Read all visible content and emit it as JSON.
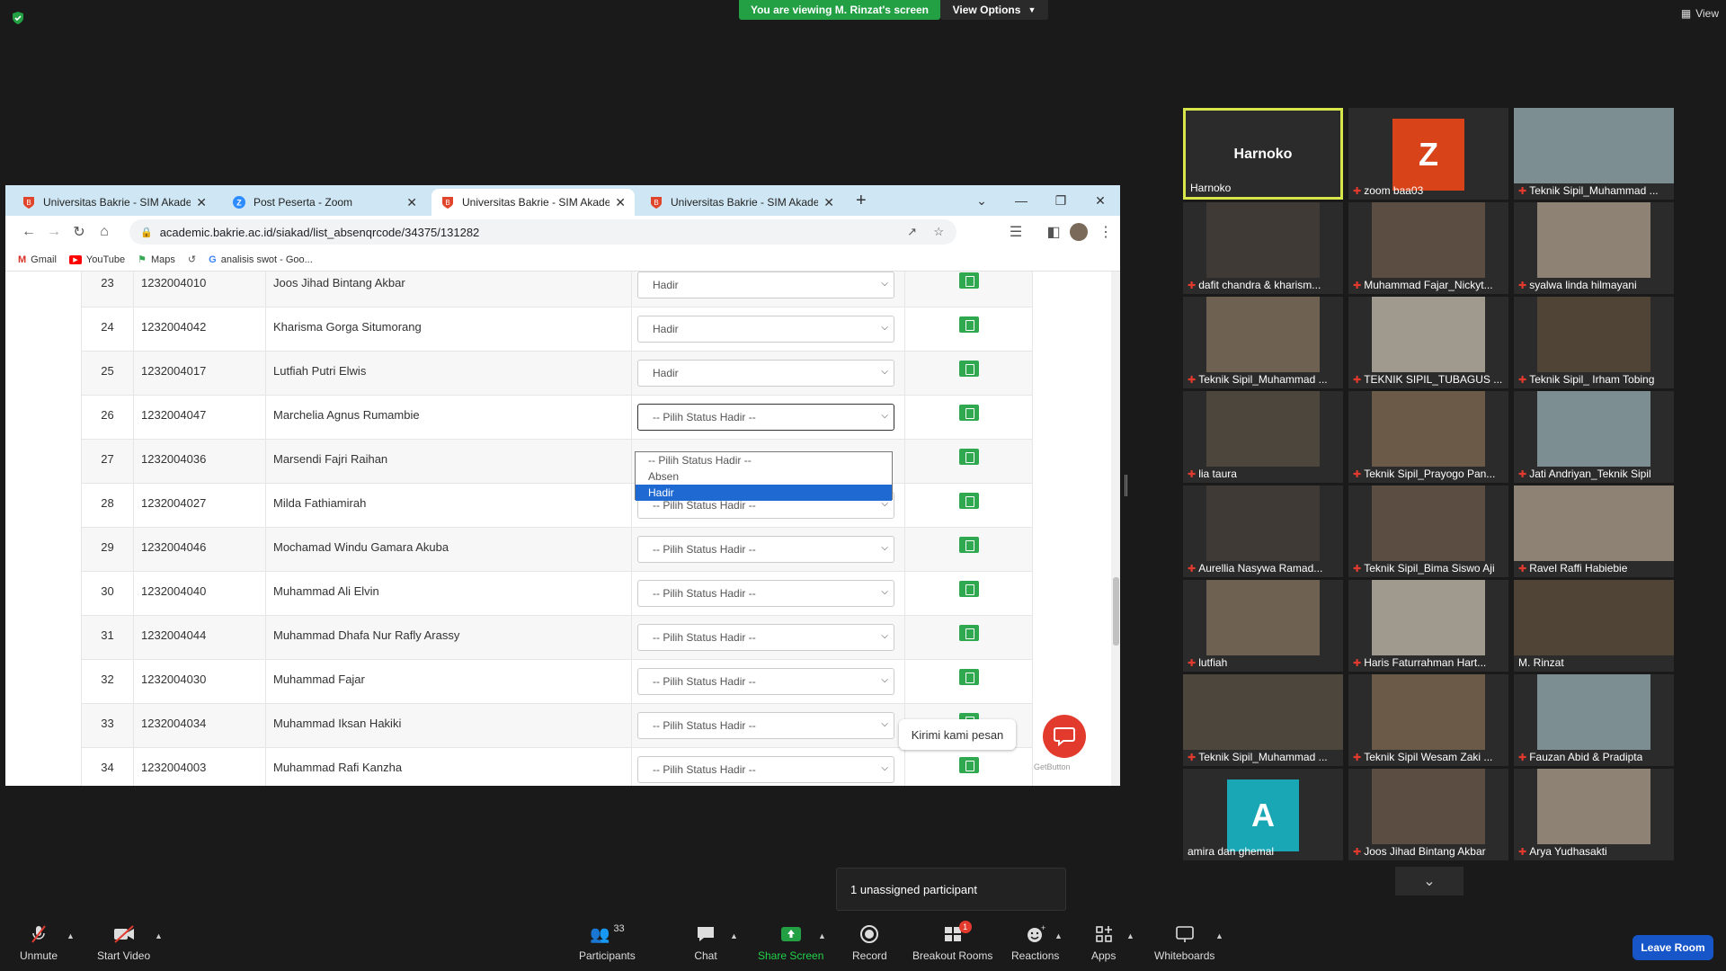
{
  "zoom": {
    "banner": "You are viewing M. Rinzat's screen",
    "view_options": "View Options",
    "view": "View",
    "unassigned_tooltip": "1 unassigned participant",
    "bottom": {
      "unmute": "Unmute",
      "start_video": "Start Video",
      "participants": "Participants",
      "participants_count": "33",
      "chat": "Chat",
      "share_screen": "Share Screen",
      "record": "Record",
      "breakout_rooms": "Breakout Rooms",
      "breakout_badge": "1",
      "reactions": "Reactions",
      "apps": "Apps",
      "whiteboards": "Whiteboards",
      "leave_room": "Leave Room"
    },
    "accent_green": "#23a044",
    "leave_blue": "#1756c8"
  },
  "browser": {
    "tabs": [
      {
        "label": "Universitas Bakrie - SIM Akadem"
      },
      {
        "label": "Post Peserta - Zoom"
      },
      {
        "label": "Universitas Bakrie - SIM Akadem"
      },
      {
        "label": "Universitas Bakrie - SIM Akadem"
      }
    ],
    "url": "academic.bakrie.ac.id/siakad/list_absenqrcode/34375/131282",
    "bookmarks": [
      "Gmail",
      "YouTube",
      "Maps",
      "analisis swot - Goo..."
    ]
  },
  "attendance": {
    "rows": [
      {
        "no": "23",
        "nim": "1232004010",
        "name": "Joos Jihad Bintang Akbar",
        "status": "Hadir"
      },
      {
        "no": "24",
        "nim": "1232004042",
        "name": "Kharisma Gorga Situmorang",
        "status": "Hadir"
      },
      {
        "no": "25",
        "nim": "1232004017",
        "name": "Lutfiah Putri Elwis",
        "status": "Hadir"
      },
      {
        "no": "26",
        "nim": "1232004047",
        "name": "Marchelia Agnus Rumambie",
        "status": "-- Pilih Status Hadir --"
      },
      {
        "no": "27",
        "nim": "1232004036",
        "name": "Marsendi Fajri Raihan",
        "status": ""
      },
      {
        "no": "28",
        "nim": "1232004027",
        "name": "Milda Fathiamirah",
        "status": "-- Pilih Status Hadir --"
      },
      {
        "no": "29",
        "nim": "1232004046",
        "name": "Mochamad Windu Gamara Akuba",
        "status": "-- Pilih Status Hadir --"
      },
      {
        "no": "30",
        "nim": "1232004040",
        "name": "Muhammad Ali Elvin",
        "status": "-- Pilih Status Hadir --"
      },
      {
        "no": "31",
        "nim": "1232004044",
        "name": "Muhammad Dhafa Nur Rafly Arassy",
        "status": "-- Pilih Status Hadir --"
      },
      {
        "no": "32",
        "nim": "1232004030",
        "name": "Muhammad Fajar",
        "status": "-- Pilih Status Hadir --"
      },
      {
        "no": "33",
        "nim": "1232004034",
        "name": "Muhammad Iksan Hakiki",
        "status": "-- Pilih Status Hadir --"
      },
      {
        "no": "34",
        "nim": "1232004003",
        "name": "Muhammad Rafi Kanzha",
        "status": "-- Pilih Status Hadir --"
      }
    ],
    "dropdown_options": [
      "-- Pilih Status Hadir --",
      "Absen",
      "Hadir"
    ],
    "dropdown_selected": "Hadir",
    "chat_tooltip": "Kirimi kami pesan",
    "getbutton": "GetButton"
  },
  "participants": [
    {
      "name": "Harnoko",
      "big": "Harnoko",
      "muted": false
    },
    {
      "name": "zoom baa03",
      "avatar": "Z",
      "avatar_color": "#d9431a",
      "muted": true
    },
    {
      "name": "Teknik Sipil_Muhammad ...",
      "muted": true
    },
    {
      "name": "dafit chandra & kharism...",
      "muted": true
    },
    {
      "name": "Muhammad Fajar_Nickyt...",
      "muted": true
    },
    {
      "name": "syalwa linda hilmayani",
      "muted": true
    },
    {
      "name": "Teknik Sipil_Muhammad ...",
      "muted": true
    },
    {
      "name": "TEKNIK SIPIL_TUBAGUS ...",
      "muted": true
    },
    {
      "name": "Teknik Sipil_ Irham Tobing",
      "muted": true
    },
    {
      "name": "lia taura",
      "muted": true
    },
    {
      "name": "Teknik Sipil_Prayogo Pan...",
      "muted": true
    },
    {
      "name": "Jati Andriyan_Teknik Sipil",
      "muted": true
    },
    {
      "name": "Aurellia Nasywa Ramad...",
      "muted": true
    },
    {
      "name": "Teknik Sipil_Bima Siswo Aji",
      "muted": true
    },
    {
      "name": "Ravel Raffi Habiebie",
      "muted": true
    },
    {
      "name": "lutfiah",
      "muted": true
    },
    {
      "name": "Haris Faturrahman Hart...",
      "muted": true
    },
    {
      "name": "M. Rinzat",
      "muted": false
    },
    {
      "name": "Teknik Sipil_Muhammad ...",
      "muted": true
    },
    {
      "name": "Teknik Sipil Wesam Zaki ...",
      "muted": true
    },
    {
      "name": "Fauzan Abid & Pradipta",
      "muted": true
    },
    {
      "name": "amira dan ghemal",
      "avatar": "A",
      "avatar_color": "#1aa7b5",
      "muted": false
    },
    {
      "name": "Joos Jihad Bintang Akbar",
      "muted": true
    },
    {
      "name": "Arya Yudhasakti",
      "muted": true
    }
  ]
}
